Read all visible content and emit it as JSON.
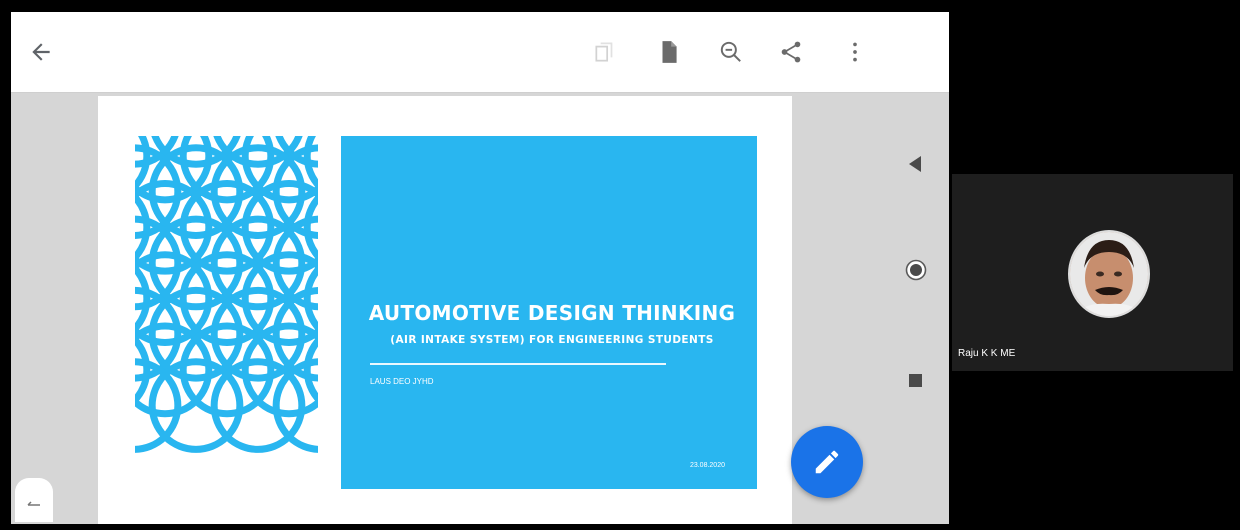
{
  "toolbar": {
    "icons": [
      "back-arrow-icon",
      "copy-icon",
      "document-icon",
      "zoom-out-icon",
      "share-icon",
      "more-vert-icon"
    ]
  },
  "slide": {
    "title": "AUTOMOTIVE DESIGN THINKING",
    "subtitle": "(AIR INTAKE SYSTEM) FOR ENGINEERING STUDENTS",
    "author": "LAUS DEO JYHD",
    "date": "23.08.2020",
    "accent_color": "#29b6f0",
    "pattern_color": "#29b6f0"
  },
  "side_nav": {
    "icons": [
      "nav-back-icon",
      "nav-home-icon",
      "nav-recents-icon"
    ]
  },
  "fab": {
    "icon": "pencil-icon",
    "color": "#1a73e8"
  },
  "participant": {
    "name": "Raju K K ME"
  }
}
